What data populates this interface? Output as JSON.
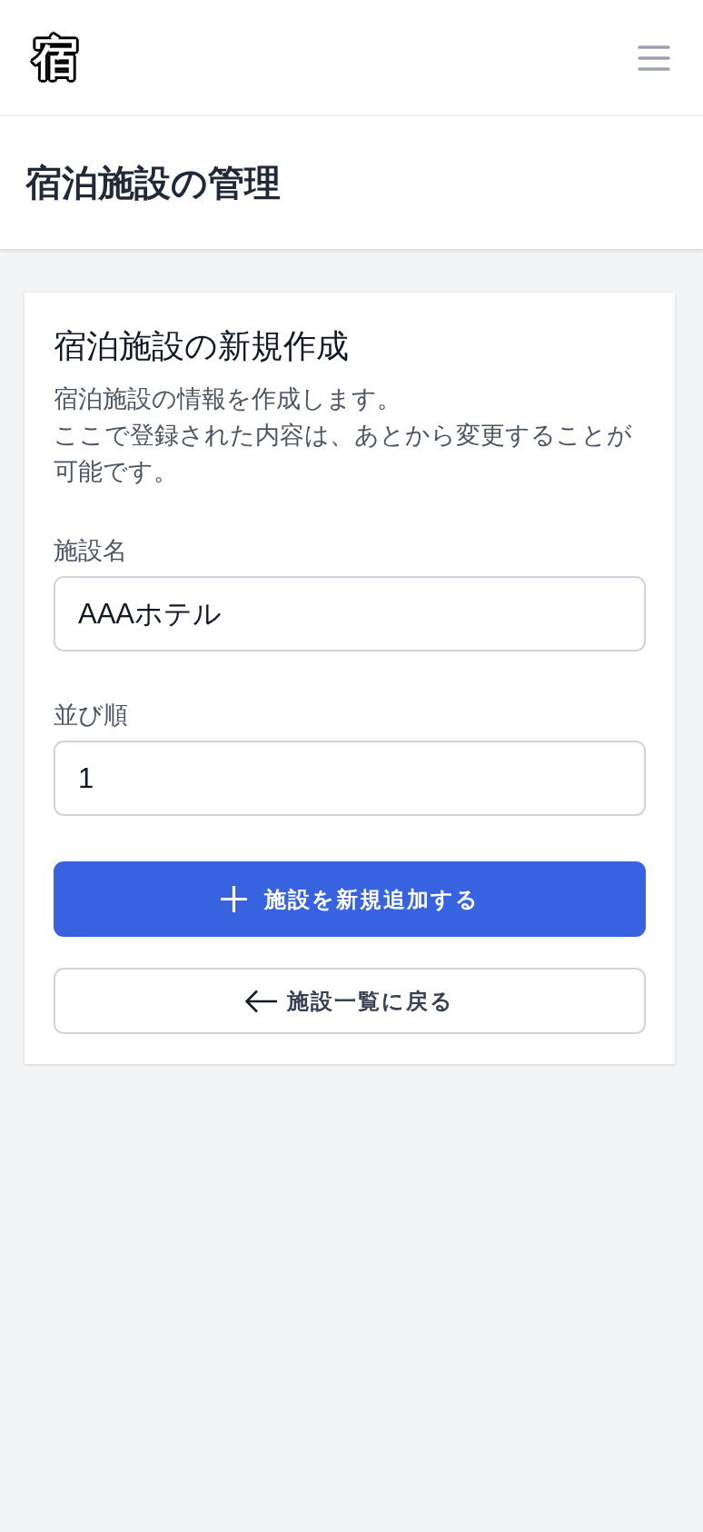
{
  "navbar": {
    "logo": "宿"
  },
  "page_header": {
    "title": "宿泊施設の管理"
  },
  "card": {
    "title": "宿泊施設の新規作成",
    "description": [
      "宿泊施設の情報を作成します。",
      "ここで登録された内容は、あとから変更することが可能です。"
    ],
    "fields": [
      {
        "label": "施設名",
        "value": "AAAホテル"
      },
      {
        "label": "並び順",
        "value": "1"
      }
    ],
    "buttons": [
      {
        "kind": "primary",
        "label": "施設を新規追加する"
      },
      {
        "kind": "secondary",
        "label": "施設一覧に戻る"
      }
    ]
  }
}
